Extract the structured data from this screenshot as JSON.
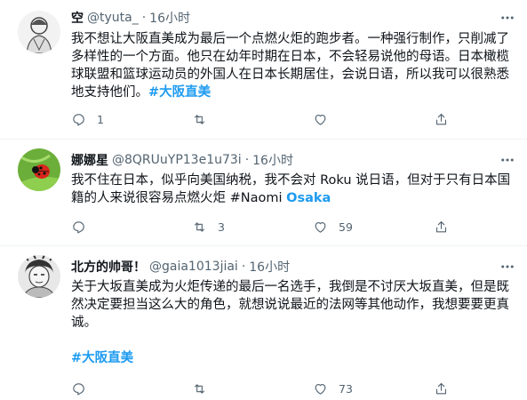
{
  "tweets": [
    {
      "name": "空",
      "handle": "@tyuta_",
      "dot": "·",
      "time": "16小时",
      "text": "我不想让大阪直美成为最后一个点燃火炬的跑步者。一种强行制作，只削减了多样性的一个方面。他只在幼年时期在日本，不会轻易说他的母语。日本橄榄球联盟和篮球运动员的外国人在日本长期居住，会说日语，所以我可以很熟悉地支持他们。",
      "hashtag": "#大阪直美",
      "reply_count": "1",
      "retweet_count": "",
      "like_count": ""
    },
    {
      "name": "娜娜星",
      "handle": "@8QRUuYP13e1u73i",
      "dot": "·",
      "time": "16小时",
      "text": "我不住在日本，似乎向美国纳税，我不会对 Roku 说日语，但对于只有日本国籍的人来说很容易点燃火炬 #Naomi ",
      "highlight": "Osaka",
      "reply_count": "",
      "retweet_count": "3",
      "like_count": "59"
    },
    {
      "name": "北方的帅哥！",
      "handle": "@gaia1013jiai",
      "dot": "·",
      "time": "16小时",
      "text": "关于大坂直美成为火炬传递的最后一名选手，我倒是不讨厌大坂直美，但是既然决定要担当这么大的角色，就想说说最近的法网等其他动作，我想要要更真诚。",
      "hashtag": "#大阪直美",
      "reply_count": "",
      "retweet_count": "",
      "like_count": "73"
    }
  ],
  "icons": [
    "reply-icon",
    "retweet-icon",
    "like-icon",
    "share-icon",
    "more-icon"
  ],
  "colors": {
    "accent": "#1d9bf0",
    "secondary": "#536471",
    "divider": "#eff3f4"
  }
}
